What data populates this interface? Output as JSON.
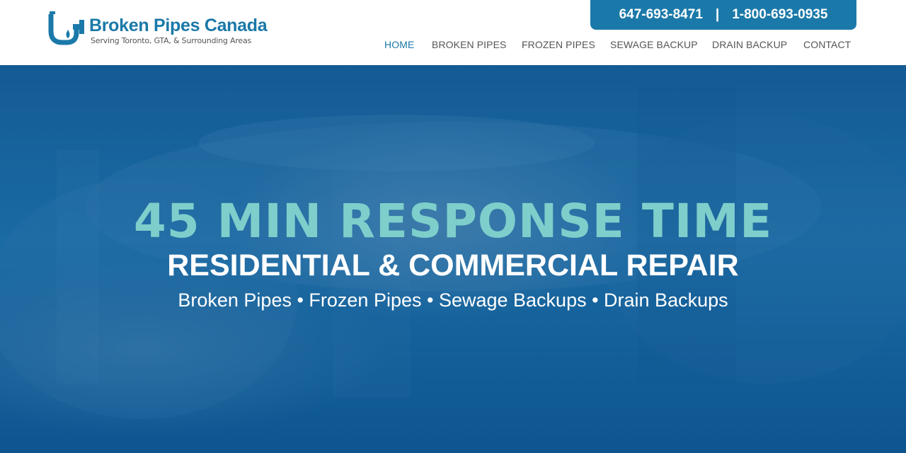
{
  "brand": {
    "name": "Broken Pipes Canada",
    "tagline": "Serving Toronto, GTA, & Surrounding Areas",
    "color": "#1b79a9"
  },
  "contact": {
    "phone_local": "647-693-8471",
    "separator": "|",
    "phone_tollfree": "1-800-693-0935"
  },
  "nav": {
    "items": [
      {
        "label": "HOME",
        "active": true
      },
      {
        "label": "BROKEN PIPES",
        "active": false
      },
      {
        "label": "FROZEN PIPES",
        "active": false
      },
      {
        "label": "SEWAGE BACKUP",
        "active": false
      },
      {
        "label": "DRAIN BACKUP",
        "active": false
      },
      {
        "label": "CONTACT",
        "active": false
      }
    ]
  },
  "hero": {
    "headline": "45 MIN RESPONSE TIME",
    "subheadline": "RESIDENTIAL & COMMERCIAL REPAIR",
    "services": "Broken Pipes • Frozen Pipes • Sewage Backups • Drain Backups",
    "headline_color": "#7ecfcb",
    "overlay_color": "#145b94"
  }
}
